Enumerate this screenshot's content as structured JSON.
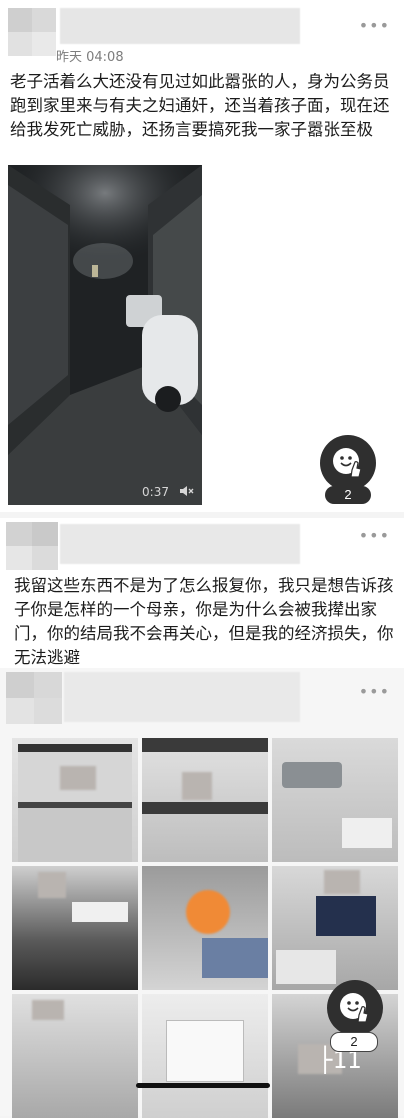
{
  "posts": [
    {
      "timestamp": "昨天 04:08",
      "text": "老子活着么大还没有见过如此嚣张的人，身为公务员跑到家里来与有夫之妇通奸，还当着孩子面，现在还给我发死亡威胁，还扬言要搞死我一家子嚣张至极",
      "video": {
        "duration": "0:37",
        "mute_icon": "speaker-muted-icon"
      },
      "more_icon": "more-dots-icon"
    },
    {
      "text": "我留这些东西不是为了怎么报复你，我只是想告诉孩子你是怎样的一个母亲，你是为什么会被我撵出家门，你的结局我不会再关心，但是我的经济损失，你无法逃避",
      "more_icon": "more-dots-icon"
    },
    {
      "more_icon": "more-dots-icon",
      "photos": [
        "photo-1",
        "photo-2",
        "photo-3",
        "photo-4",
        "photo-5",
        "photo-6",
        "photo-7",
        "photo-8",
        "photo-9"
      ]
    }
  ],
  "floating_badges": [
    {
      "count": "2",
      "icon": "touch-hand-icon"
    },
    {
      "count": "2",
      "icon": "touch-hand-icon"
    }
  ],
  "partial_overlay_text": "├11"
}
